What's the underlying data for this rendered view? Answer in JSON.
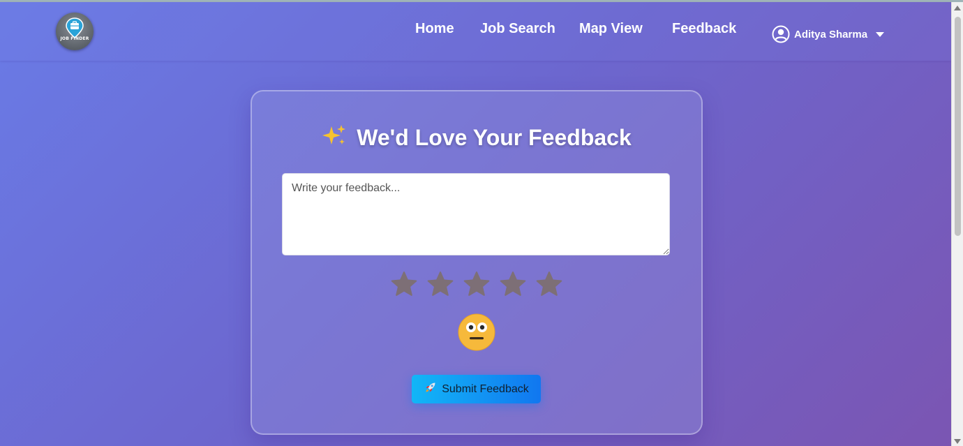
{
  "nav": {
    "logo_text": "JOB FINDER",
    "links": [
      "Home",
      "Job Search",
      "Map View",
      "Feedback"
    ],
    "user_name": "Aditya Sharma"
  },
  "feedback": {
    "title": "We'd Love Your Feedback",
    "placeholder": "Write your feedback...",
    "rating": 0,
    "max_rating": 5,
    "submit_label": "Submit Feedback"
  },
  "icons": {
    "logo": "job-finder-logo",
    "user": "user-circle-icon",
    "caret": "caret-down-icon",
    "title": "sparkles-icon",
    "star": "star-icon",
    "mood": "neutral-face-emoji",
    "submit": "rocket-icon"
  },
  "colors": {
    "star_empty": "#7d6f76",
    "emoji_face": "#f6b93b",
    "button_start": "#12b6f7",
    "button_end": "#1177f0"
  }
}
